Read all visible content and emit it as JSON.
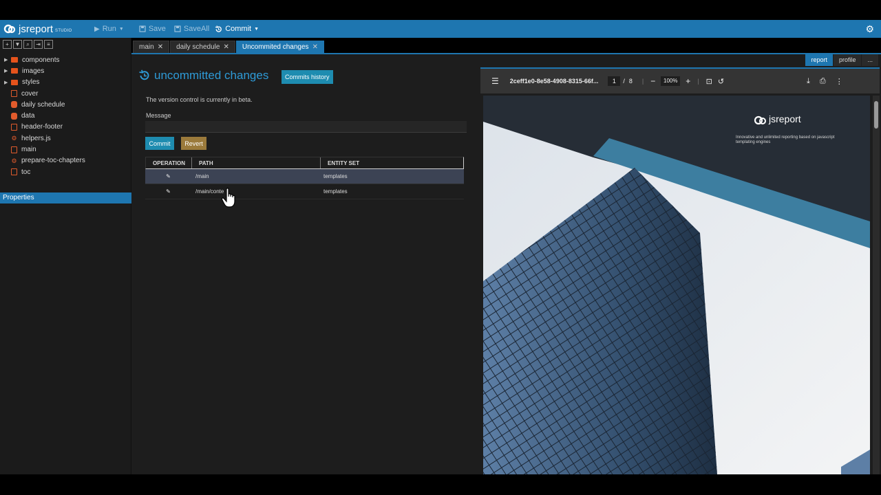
{
  "app": {
    "brand": "jsreport",
    "brand_sub": "STUDIO"
  },
  "toolbar": {
    "run": "Run",
    "save": "Save",
    "saveall": "SaveAll",
    "commit": "Commit"
  },
  "tree": {
    "items": [
      {
        "label": "components",
        "type": "folder"
      },
      {
        "label": "images",
        "type": "folder"
      },
      {
        "label": "styles",
        "type": "folder"
      },
      {
        "label": "cover",
        "type": "file"
      },
      {
        "label": "daily schedule",
        "type": "db"
      },
      {
        "label": "data",
        "type": "db"
      },
      {
        "label": "header-footer",
        "type": "file"
      },
      {
        "label": "helpers.js",
        "type": "js"
      },
      {
        "label": "main",
        "type": "file"
      },
      {
        "label": "prepare-toc-chapters",
        "type": "js"
      },
      {
        "label": "toc",
        "type": "file"
      }
    ],
    "properties": "Properties"
  },
  "tabs": [
    {
      "label": "main"
    },
    {
      "label": "daily schedule"
    },
    {
      "label": "Uncommited changes"
    }
  ],
  "changes": {
    "title": "uncommitted changes",
    "history_btn": "Commits history",
    "beta_note": "The version control is currently in beta.",
    "message_label": "Message",
    "message_value": "",
    "commit_btn": "Commit",
    "revert_btn": "Revert",
    "columns": [
      "OPERATION",
      "PATH",
      "ENTITY SET"
    ],
    "rows": [
      {
        "path": "/main",
        "entity_set": "templates"
      },
      {
        "path": "/main/conte",
        "entity_set": "templates"
      }
    ]
  },
  "preview": {
    "tabs": [
      "report",
      "profile",
      "..."
    ],
    "pdf_title": "2ceff1e0-8e58-4908-8315-66f...",
    "page_current": "1",
    "page_sep": "/",
    "page_total": "8",
    "zoom": "100%",
    "doc_brand": "jsreport",
    "doc_tagline": "Innovative and unlimited reporting based on javascript templating engines"
  },
  "colors": {
    "accent": "#1e76b0",
    "commit": "#1e8cb0",
    "revert": "#9b7a3b",
    "tree_icon": "#e5531c"
  }
}
